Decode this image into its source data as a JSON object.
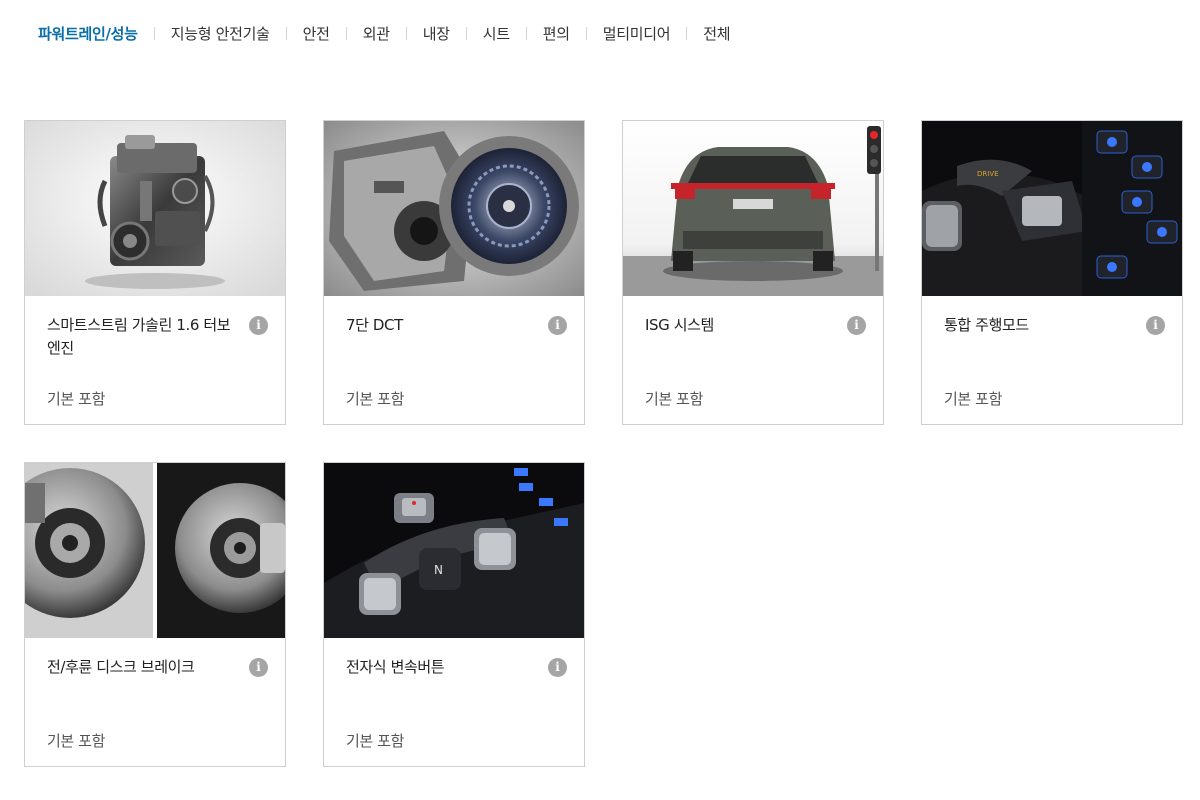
{
  "tabs": [
    {
      "label": "파워트레인/성능",
      "active": true
    },
    {
      "label": "지능형 안전기술",
      "active": false
    },
    {
      "label": "안전",
      "active": false
    },
    {
      "label": "외관",
      "active": false
    },
    {
      "label": "내장",
      "active": false
    },
    {
      "label": "시트",
      "active": false
    },
    {
      "label": "편의",
      "active": false
    },
    {
      "label": "멀티미디어",
      "active": false
    },
    {
      "label": "전체",
      "active": false
    }
  ],
  "cards": [
    {
      "title": "스마트스트림 가솔린 1.6 터보 엔진",
      "status": "기본 포함",
      "image": "engine"
    },
    {
      "title": "7단 DCT",
      "status": "기본 포함",
      "image": "transmission"
    },
    {
      "title": "ISG 시스템",
      "status": "기본 포함",
      "image": "car-rear-traffic-light"
    },
    {
      "title": "통합 주행모드",
      "status": "기본 포함",
      "image": "drive-mode-console"
    },
    {
      "title": "전/후륜 디스크 브레이크",
      "status": "기본 포함",
      "image": "disc-brakes"
    },
    {
      "title": "전자식 변속버튼",
      "status": "기본 포함",
      "image": "shift-buttons"
    }
  ],
  "info_icon": {
    "glyph": "i",
    "name": "info-icon"
  },
  "colors": {
    "active_tab": "#0a6ea8",
    "info_icon": "#a5a5a5",
    "card_border": "#cfcfcf"
  }
}
